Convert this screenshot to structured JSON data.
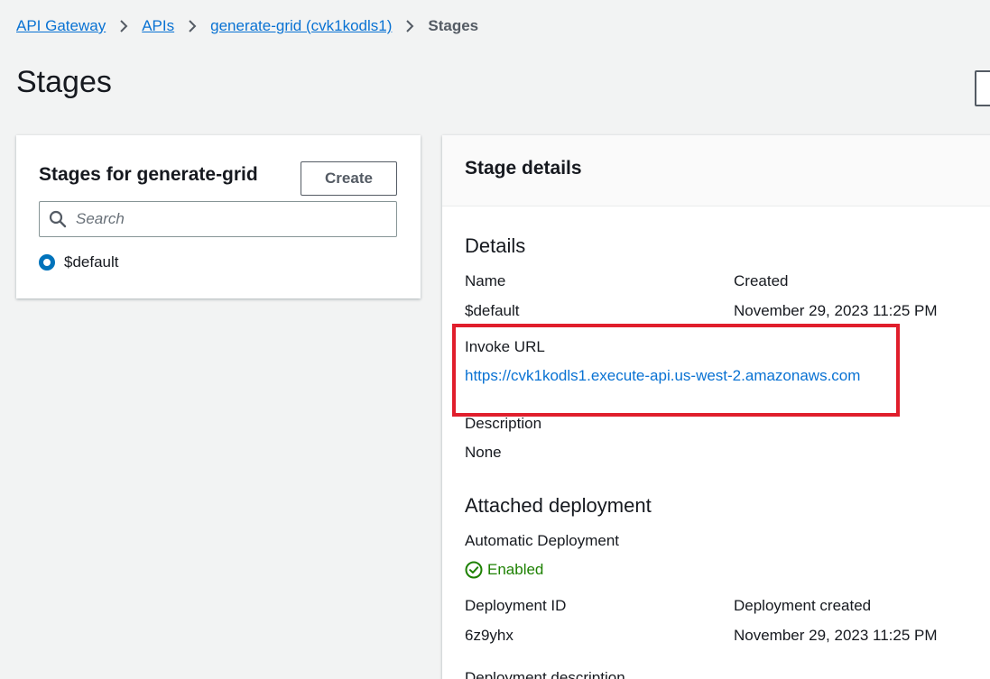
{
  "breadcrumb": {
    "items": [
      "API Gateway",
      "APIs",
      "generate-grid (cvk1kodls1)"
    ],
    "current": "Stages"
  },
  "page_title": "Stages",
  "stages_panel": {
    "heading": "Stages for generate-grid",
    "create_label": "Create",
    "search_placeholder": "Search",
    "stages": [
      "$default"
    ]
  },
  "stage_details": {
    "header": "Stage details",
    "details_section": "Details",
    "name_label": "Name",
    "name_value": "$default",
    "created_label": "Created",
    "created_value": "November 29, 2023 11:25 PM",
    "invoke_url_label": "Invoke URL",
    "invoke_url_value": "https://cvk1kodls1.execute-api.us-west-2.amazonaws.com",
    "description_label": "Description",
    "description_value": "None",
    "attached_section": "Attached deployment",
    "auto_deploy_label": "Automatic Deployment",
    "auto_deploy_value": "Enabled",
    "deployment_id_label": "Deployment ID",
    "deployment_id_value": "6z9yhx",
    "deployment_created_label": "Deployment created",
    "deployment_created_value": "November 29, 2023 11:25 PM",
    "deployment_description_label": "Deployment description"
  },
  "colors": {
    "link": "#0972d3",
    "success": "#1d8102",
    "highlight": "#e01e2c",
    "radio_selected": "#0073bb"
  },
  "icons": [
    "chevron-right-icon",
    "search-icon",
    "check-circle-icon"
  ]
}
